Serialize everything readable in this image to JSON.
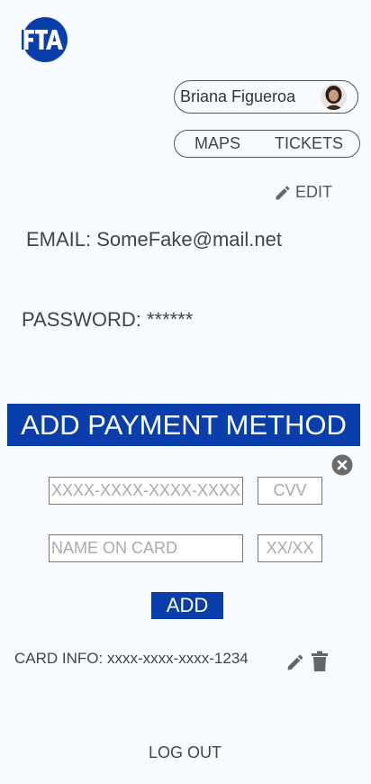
{
  "header": {
    "logo_text": "FTA",
    "brand_color": "#0a3eab"
  },
  "user": {
    "name": "Briana Figueroa"
  },
  "nav": {
    "maps_label": "MAPS",
    "tickets_label": "TICKETS"
  },
  "profile": {
    "edit_label": "EDIT",
    "email_line": "EMAIL: SomeFake@mail.net",
    "password_line": "PASSWORD: ******"
  },
  "payment": {
    "title": "ADD PAYMENT METHOD",
    "card_number_placeholder": "XXXX-XXXX-XXXX-XXXX",
    "cvv_placeholder": "CVV",
    "name_placeholder": "NAME ON CARD",
    "expiry_placeholder": "XX/XX",
    "add_label": "ADD"
  },
  "card": {
    "info_text": "CARD INFO: xxxx-xxxx-xxxx-1234"
  },
  "footer": {
    "logout_label": "LOG OUT"
  },
  "icons": {
    "edit": "pencil-icon",
    "delete": "trash-icon",
    "close": "close-circle-icon"
  }
}
